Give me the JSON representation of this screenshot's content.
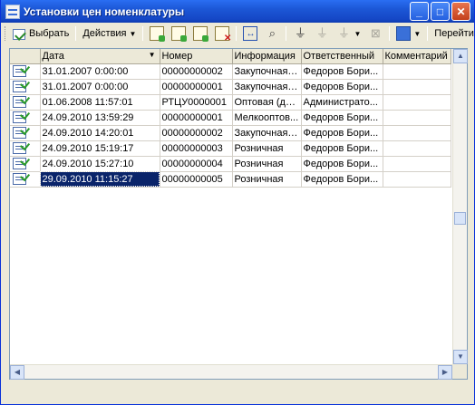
{
  "window": {
    "title": "Установки цен номенклатуры",
    "minimize": "_",
    "maximize": "□",
    "close": "✕"
  },
  "toolbar": {
    "select_label": "Выбрать",
    "actions_label": "Действия",
    "goto_label": "Перейти",
    "icons": [
      "select-icon",
      "add-icon",
      "add-group-icon",
      "edit-icon",
      "delete-icon",
      "interval-icon",
      "search-icon",
      "filter-icon",
      "filter-by-value-icon",
      "filter-history-icon",
      "clear-filter-icon",
      "navigate-icon"
    ]
  },
  "table": {
    "columns": [
      "",
      "Дата",
      "Номер",
      "Информация",
      "Ответственный",
      "Комментарий"
    ],
    "rows": [
      {
        "date": "31.01.2007 0:00:00",
        "number": "00000000002",
        "info": "Закупочная,...",
        "responsible": "Федоров Бори...",
        "comment": ""
      },
      {
        "date": "31.01.2007 0:00:00",
        "number": "00000000001",
        "info": "Закупочная,...",
        "responsible": "Федоров Бори...",
        "comment": ""
      },
      {
        "date": "01.06.2008 11:57:01",
        "number": "РТЦУ0000001",
        "info": "Оптовая (дл...",
        "responsible": "Администрато...",
        "comment": ""
      },
      {
        "date": "24.09.2010 13:59:29",
        "number": "00000000001",
        "info": "Мелкооптов...",
        "responsible": "Федоров Бори...",
        "comment": ""
      },
      {
        "date": "24.09.2010 14:20:01",
        "number": "00000000002",
        "info": "Закупочная,...",
        "responsible": "Федоров Бори...",
        "comment": ""
      },
      {
        "date": "24.09.2010 15:19:17",
        "number": "00000000003",
        "info": "Розничная",
        "responsible": "Федоров Бори...",
        "comment": ""
      },
      {
        "date": "24.09.2010 15:27:10",
        "number": "00000000004",
        "info": "Розничная",
        "responsible": "Федоров Бори...",
        "comment": ""
      },
      {
        "date": "29.09.2010 11:15:27",
        "number": "00000000005",
        "info": "Розничная",
        "responsible": "Федоров Бори...",
        "comment": ""
      }
    ],
    "selected_row": 7,
    "sort_indicator": "▼"
  },
  "scroll": {
    "up": "▲",
    "down": "▼",
    "left": "◀",
    "right": "▶"
  },
  "colors": {
    "selection": "#0a246a",
    "titlebar": "#1c57d6",
    "face": "#ece9d8"
  }
}
